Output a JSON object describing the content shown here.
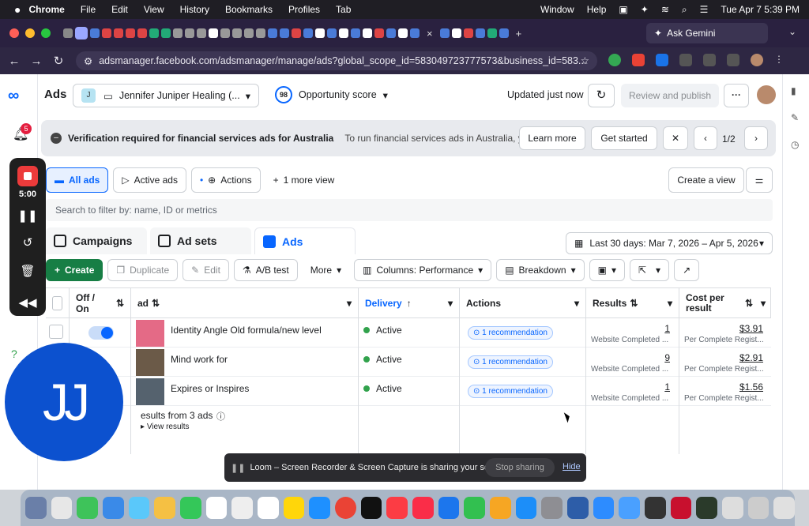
{
  "menubar": {
    "app": "Chrome",
    "items": [
      "File",
      "Edit",
      "View",
      "History",
      "Bookmarks",
      "Profiles",
      "Tab",
      "Window",
      "Help"
    ],
    "datetime": "Tue Apr 7  5:39 PM"
  },
  "browser": {
    "url": "adsmanager.facebook.com/adsmanager/manage/ads?global_scope_id=583049723777573&business_id=583...",
    "ask_gemini": "Ask Gemini",
    "tab_close": "×",
    "new_tab": "+"
  },
  "header": {
    "product": "Ads",
    "account_name": "Jennifer Juniper Healing (...",
    "account_badge": "J",
    "opportunity_score": "98",
    "opportunity_label": "Opportunity score",
    "updated": "Updated just now",
    "review_publish": "Review and publish",
    "more": "···"
  },
  "banner": {
    "title": "Verification required for financial services ads for Australia",
    "text": "To run financial services ads in Australia, you ...",
    "learn_more": "Learn more",
    "get_started": "Get started",
    "close": "✕",
    "pager": "1/2"
  },
  "views": {
    "all_ads": "All ads",
    "active_ads": "Active ads",
    "actions": "Actions",
    "more_view": "1 more view",
    "create_view": "Create a view"
  },
  "search": {
    "placeholder": "Search to filter by: name, ID or metrics"
  },
  "levels": {
    "campaigns": "Campaigns",
    "ad_sets": "Ad sets",
    "ads": "Ads"
  },
  "date_range": "Last 30 days: Mar 7, 2026 – Apr 5, 2026",
  "toolbar": {
    "create": "Create",
    "duplicate": "Duplicate",
    "edit": "Edit",
    "ab_test": "A/B test",
    "more": "More",
    "columns": "Columns: Performance",
    "breakdown": "Breakdown"
  },
  "table": {
    "headers": {
      "off_on": "Off / On",
      "ad": "ad",
      "delivery": "Delivery",
      "actions": "Actions",
      "results": "Results",
      "cost_per_result": "Cost per result"
    },
    "rows": [
      {
        "name": "Identity Angle Old formula/new level",
        "delivery": "Active",
        "recommendation": "1 recommendation",
        "results": "1",
        "results_label": "Website Completed ...",
        "cost": "$3.91",
        "cost_label": "Per Complete Regist..."
      },
      {
        "name": "Mind work for",
        "delivery": "Active",
        "recommendation": "1 recommendation",
        "results": "9",
        "results_label": "Website Completed ...",
        "cost": "$2.91",
        "cost_label": "Per Complete Regist..."
      },
      {
        "name": "Expires or Inspires",
        "delivery": "Active",
        "recommendation": "1 recommendation",
        "results": "1",
        "results_label": "Website Completed ...",
        "cost": "$1.56",
        "cost_label": "Per Complete Regist..."
      }
    ],
    "summary": {
      "text": "esults from 3 ads",
      "view_results": "View results"
    }
  },
  "loom": {
    "timer": "5:00",
    "camera_initials": "JJ",
    "share_text": "Loom – Screen Recorder & Screen Capture is sharing your screen.",
    "stop_sharing": "Stop sharing",
    "hide": "Hide"
  },
  "notifications_badge": "5",
  "colors": {
    "brand_blue": "#0866ff",
    "create_green": "#177e45",
    "active_green": "#31a24c"
  }
}
